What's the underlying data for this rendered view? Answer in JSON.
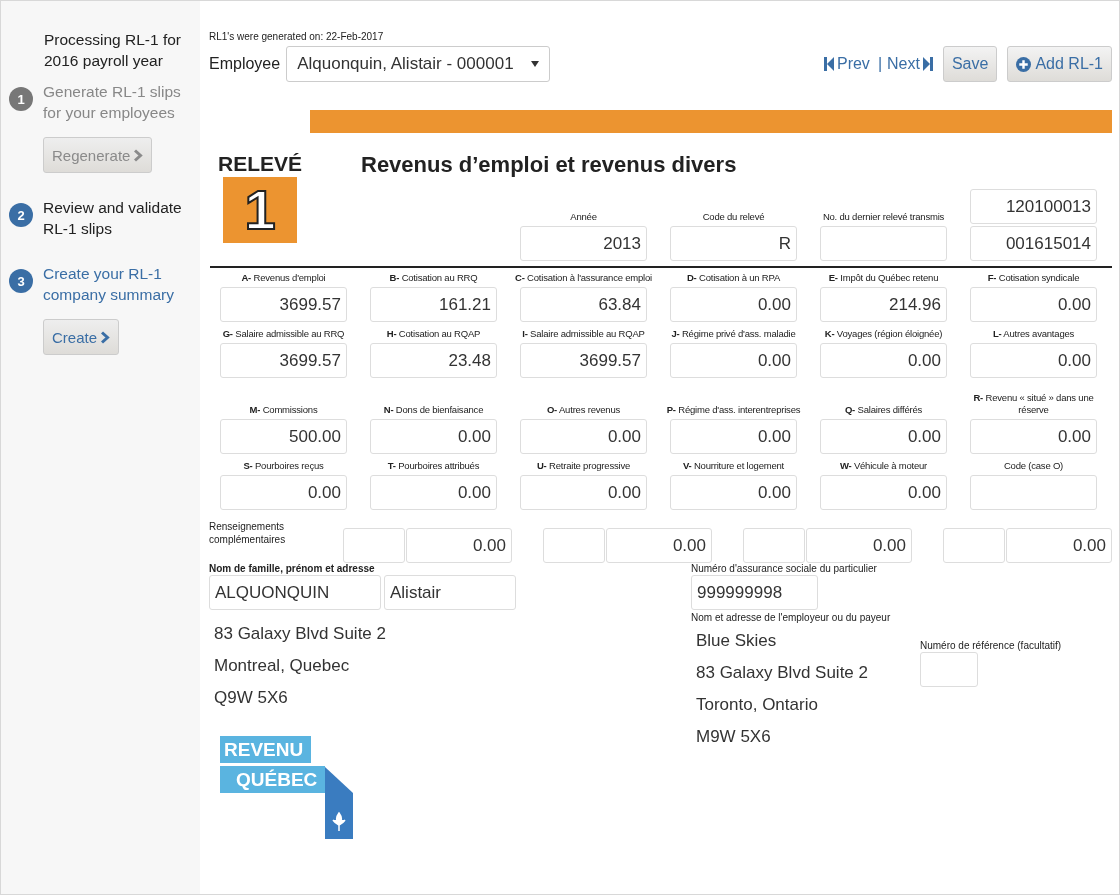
{
  "sidebar": {
    "title": "Processing RL-1 for 2016 payroll year",
    "steps": [
      {
        "number": "1",
        "kind": "done",
        "text": "Generate RL-1 slips for your employees",
        "button": {
          "label": "Regenerate",
          "disabled": true
        }
      },
      {
        "number": "2",
        "kind": "current",
        "text": "Review and validate RL-1 slips"
      },
      {
        "number": "3",
        "kind": "todo",
        "text": "Create your RL-1 company summary",
        "button": {
          "label": "Create",
          "disabled": false
        }
      }
    ]
  },
  "toolbar": {
    "generated": "RL1's were generated on: 22-Feb-2017",
    "employee_label": "Employee",
    "employee_value": "Alquonquin, Alistair - 000001",
    "prev": "Prev",
    "separator": "|",
    "next": "Next",
    "save": "Save",
    "add": "Add RL-1"
  },
  "slip": {
    "badge_word": "RELEVÉ",
    "badge_number": "1",
    "title": "Revenus d’emploi et revenus divers",
    "header_fields": [
      {
        "label": "Année",
        "value": "2013"
      },
      {
        "label": "Code du relevé",
        "value": "R"
      },
      {
        "label": "No. du dernier relevé transmis"
      }
    ],
    "numbers": [
      "120100013",
      "001615014"
    ],
    "rows": [
      [
        {
          "label": "**A-** Revenus d'emploi",
          "value": "3699.57"
        },
        {
          "label": "**B-** Cotisation au RRQ",
          "value": "161.21"
        },
        {
          "label": "**C-** Cotisation à l'assurance emploi",
          "value": "63.84"
        },
        {
          "label": "**D-** Cotisation à un RPA",
          "value": "0.00"
        },
        {
          "label": "**E-** Impôt du Québec retenu",
          "value": "214.96"
        },
        {
          "label": "**F-** Cotisation syndicale",
          "value": "0.00"
        }
      ],
      [
        {
          "label": "**G-** Salaire admissible au RRQ",
          "value": "3699.57"
        },
        {
          "label": "**H-** Cotisation au RQAP",
          "value": "23.48"
        },
        {
          "label": "**I-** Salaire admissible au RQAP",
          "value": "3699.57"
        },
        {
          "label": "**J-** Régime privé d'ass. maladie",
          "value": "0.00"
        },
        {
          "label": "**K-** Voyages (région éloignée)",
          "value": "0.00"
        },
        {
          "label": "**L-** Autres avantages",
          "value": "0.00"
        }
      ],
      [
        {
          "label": "**M-** Commissions",
          "value": "500.00"
        },
        {
          "label": "**N-** Dons de bienfaisance",
          "value": "0.00"
        },
        {
          "label": "**O-** Autres revenus",
          "value": "0.00"
        },
        {
          "label": "**P-** Régime d'ass. interentreprises",
          "value": "0.00"
        },
        {
          "label": "**Q-** Salaires différés",
          "value": "0.00"
        },
        {
          "label": "**R-** Revenu « situé » dans une réserve",
          "value": "0.00"
        }
      ],
      [
        {
          "label": "**S-** Pourboires reçus",
          "value": "0.00"
        },
        {
          "label": "**T-** Pourboires attribués",
          "value": "0.00"
        },
        {
          "label": "**U-** Retraite progressive",
          "value": "0.00"
        },
        {
          "label": "**V-** Nourriture et logement",
          "value": "0.00"
        },
        {
          "label": "**W-** Véhicule à moteur",
          "value": "0.00"
        },
        {
          "label": "Code (case O)"
        }
      ]
    ],
    "additional": {
      "label": "Renseignements complémentaires",
      "pairs": [
        {
          "value": "0.00"
        },
        {
          "value": "0.00"
        },
        {
          "value": "0.00"
        },
        {
          "value": "0.00"
        }
      ]
    },
    "employee": {
      "label": "Nom de famille, prénom et adresse",
      "last_name": "ALQUONQUIN",
      "first_name": "Alistair",
      "address": [
        "83 Galaxy Blvd Suite 2",
        "Montreal, Quebec",
        "Q9W 5X6"
      ]
    },
    "sin": {
      "label": "Numéro d'assurance sociale du particulier",
      "value": "999999998"
    },
    "employer": {
      "label": "Nom et adresse de l'employeur ou du payeur",
      "lines": [
        "Blue Skies",
        "83 Galaxy Blvd Suite 2",
        "Toronto, Ontario",
        "M9W 5X6"
      ]
    },
    "reference": {
      "label": "Numéro de référence (facultatif)"
    },
    "agency_logo": [
      "REVENU",
      "QUÉBEC"
    ]
  }
}
